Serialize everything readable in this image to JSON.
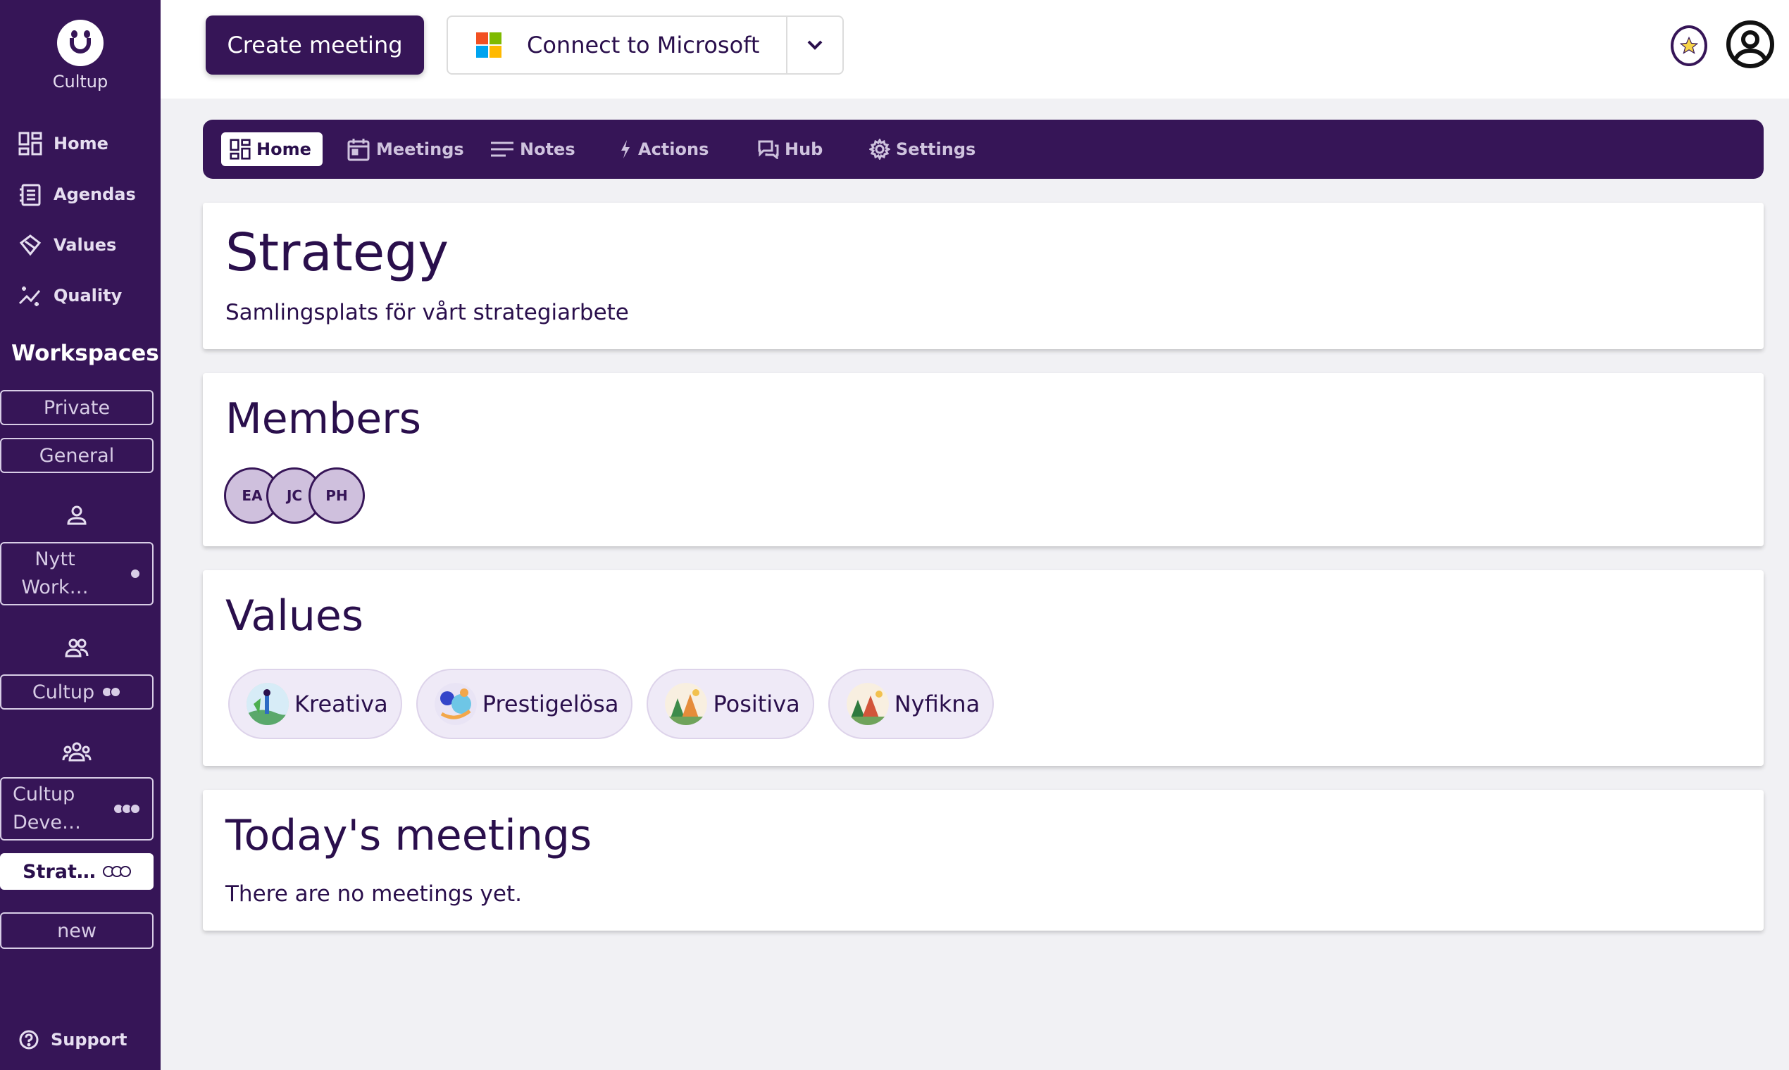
{
  "sidebar": {
    "logo_text": "Cultup",
    "nav": [
      {
        "label": "Home",
        "icon": "grid-icon"
      },
      {
        "label": "Agendas",
        "icon": "agenda-icon"
      },
      {
        "label": "Values",
        "icon": "diamond-icon"
      },
      {
        "label": "Quality",
        "icon": "sparkle-chart-icon"
      }
    ],
    "workspaces_title": "Workspaces",
    "workspaces": {
      "private": "Private",
      "general": "General",
      "nytt": "Nytt Work…",
      "cultup": "Cultup",
      "cultup_dev": "Cultup Deve…",
      "strat": "Strat…",
      "new": "new"
    },
    "support": "Support"
  },
  "topbar": {
    "create_meeting": "Create meeting",
    "connect_microsoft": "Connect to Microsoft"
  },
  "tabs": [
    {
      "label": "Home",
      "active": true
    },
    {
      "label": "Meetings"
    },
    {
      "label": "Notes"
    },
    {
      "label": "Actions"
    },
    {
      "label": "Hub"
    },
    {
      "label": "Settings"
    }
  ],
  "workspace": {
    "title": "Strategy",
    "description": "Samlingsplats för vårt strategiarbete"
  },
  "members": {
    "title": "Members",
    "list": [
      "EA",
      "JC",
      "PH"
    ]
  },
  "values": {
    "title": "Values",
    "list": [
      "Kreativa",
      "Prestigelösa",
      "Positiva",
      "Nyfikna"
    ]
  },
  "meetings": {
    "title": "Today's meetings",
    "empty": "There are no meetings yet."
  },
  "colors": {
    "brand": "#361557",
    "background": "#f1f1f4",
    "chip": "#efeaf7"
  }
}
